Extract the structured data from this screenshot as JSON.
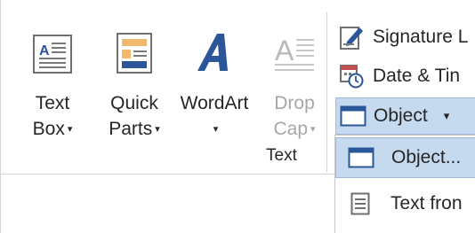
{
  "ribbon": {
    "group_label": "Text",
    "buttons": [
      {
        "line1": "Text",
        "line2": "Box",
        "icon": "text-box-icon",
        "has_dropdown": true,
        "enabled": true
      },
      {
        "line1": "Quick",
        "line2": "Parts",
        "icon": "quick-parts-icon",
        "has_dropdown": true,
        "enabled": true
      },
      {
        "line1": "WordArt",
        "line2": "",
        "icon": "wordart-icon",
        "has_dropdown": true,
        "enabled": true
      },
      {
        "line1": "Drop",
        "line2": "Cap",
        "icon": "drop-cap-icon",
        "has_dropdown": true,
        "enabled": false
      }
    ],
    "small_buttons": [
      {
        "label": "Signature L",
        "icon": "signature-line-icon"
      },
      {
        "label": "Date & Tin",
        "icon": "date-time-icon"
      }
    ],
    "object_button": {
      "label": "Object",
      "icon": "object-icon",
      "caret": "▾"
    }
  },
  "dropdown_menu": {
    "items": [
      {
        "label": "Object...",
        "icon": "object-icon",
        "highlighted": true
      },
      {
        "label": "Text fron",
        "icon": "text-from-file-icon",
        "highlighted": false
      }
    ]
  },
  "colors": {
    "accent_blue": "#2b579a",
    "hover_fill": "#c5d9ef",
    "hover_border": "#9cb8da",
    "disabled_text": "#a6a6a6"
  }
}
